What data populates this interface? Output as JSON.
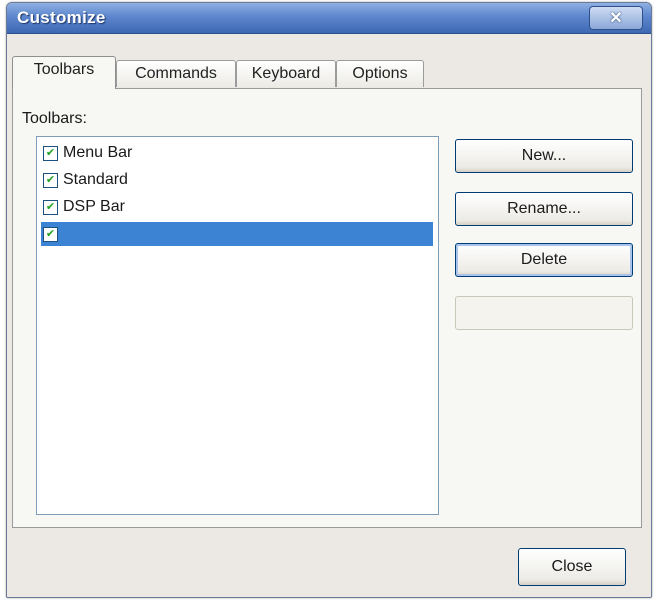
{
  "window": {
    "title": "Customize",
    "close_glyph": "✕"
  },
  "tabs": [
    {
      "label": "Toolbars"
    },
    {
      "label": "Commands"
    },
    {
      "label": "Keyboard"
    },
    {
      "label": "Options"
    }
  ],
  "toolbars_panel": {
    "list_label": "Toolbars:",
    "items": [
      {
        "label": "Menu Bar",
        "checked": true
      },
      {
        "label": "Standard",
        "checked": true
      },
      {
        "label": "DSP Bar",
        "checked": true
      },
      {
        "label": "",
        "checked": true,
        "selected": true
      }
    ],
    "buttons": {
      "new": "New...",
      "rename": "Rename...",
      "delete": "Delete",
      "reset": ""
    }
  },
  "footer": {
    "close": "Close"
  },
  "colors": {
    "selection": "#3d83d3",
    "title_bar": "#5c86cd"
  }
}
